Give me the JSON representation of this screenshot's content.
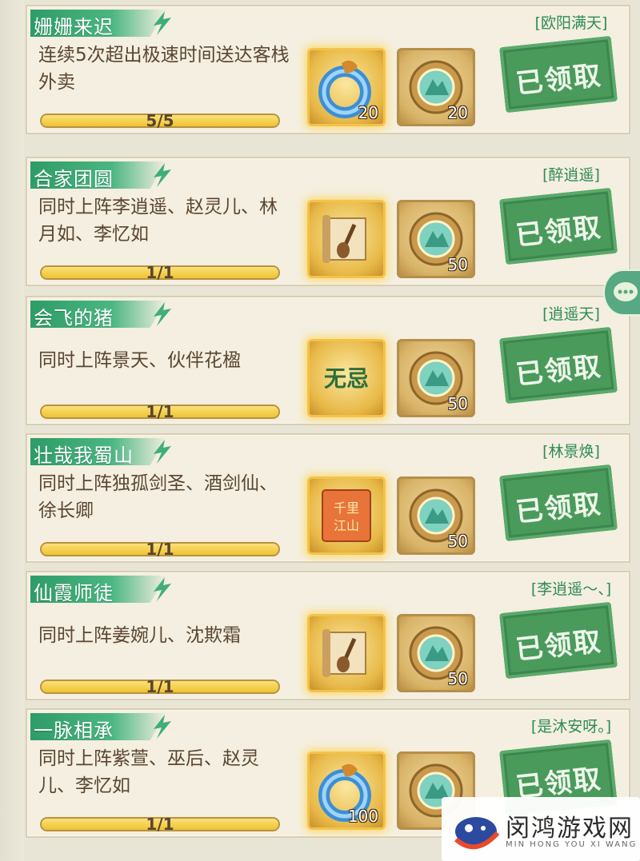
{
  "tasks": [
    {
      "title": "姗姗来迟",
      "desc": "连续5次超出极速时间送达客栈外卖",
      "progress": "5/5",
      "progress_fraction": 1.0,
      "rewards": [
        {
          "icon": "ring-jade-icon",
          "count": "20",
          "style": "gold"
        },
        {
          "icon": "jade-medallion-icon",
          "count": "20",
          "style": "plain"
        }
      ],
      "player": "[欧阳满天]",
      "status": "已领取"
    },
    {
      "title": "合家团圆",
      "desc": "同时上阵李逍遥、赵灵儿、林月如、李忆如",
      "progress": "1/1",
      "progress_fraction": 1.0,
      "rewards": [
        {
          "icon": "scroll-icon",
          "count": "",
          "style": "gold"
        },
        {
          "icon": "jade-medallion-icon",
          "count": "50",
          "style": "plain"
        }
      ],
      "player": "[醉逍遥]",
      "status": "已领取"
    },
    {
      "title": "会飞的猪",
      "desc": "同时上阵景天、伙伴花楹",
      "progress": "1/1",
      "progress_fraction": 1.0,
      "rewards": [
        {
          "icon": "wuji-badge-icon",
          "label": "无忌",
          "count": "",
          "style": "gold"
        },
        {
          "icon": "jade-medallion-icon",
          "count": "50",
          "style": "plain"
        }
      ],
      "player": "[逍遥天]",
      "status": "已领取"
    },
    {
      "title": "壮哉我蜀山",
      "desc": "同时上阵独孤剑圣、酒剑仙、徐长卿",
      "progress": "1/1",
      "progress_fraction": 1.0,
      "rewards": [
        {
          "icon": "map-scroll-icon",
          "label": "千里江山",
          "count": "",
          "style": "gold"
        },
        {
          "icon": "jade-medallion-icon",
          "count": "50",
          "style": "plain"
        }
      ],
      "player": "[林景焕]",
      "status": "已领取"
    },
    {
      "title": "仙霞师徒",
      "desc": "同时上阵姜婉儿、沈欺霜",
      "progress": "1/1",
      "progress_fraction": 1.0,
      "rewards": [
        {
          "icon": "scroll-icon",
          "count": "",
          "style": "gold"
        },
        {
          "icon": "jade-medallion-icon",
          "count": "50",
          "style": "plain"
        }
      ],
      "player": "[李逍遥～、]",
      "status": "已领取"
    },
    {
      "title": "一脉相承",
      "desc": "同时上阵紫萱、巫后、赵灵儿、李忆如",
      "progress": "1/1",
      "progress_fraction": 1.0,
      "rewards": [
        {
          "icon": "ring-jade-icon",
          "count": "100",
          "style": "gold"
        },
        {
          "icon": "jade-medallion-icon",
          "count": "",
          "style": "plain"
        }
      ],
      "player": "[是沐安呀。]",
      "status": "已领取"
    }
  ],
  "watermark": {
    "title": "闵鸿游戏网",
    "subtitle": "MIN HONG YOU XI WANG"
  },
  "colors": {
    "accent_green": "#3d9a66",
    "card_bg": "#f4efe0",
    "progress_yellow": "#f3d44e"
  }
}
